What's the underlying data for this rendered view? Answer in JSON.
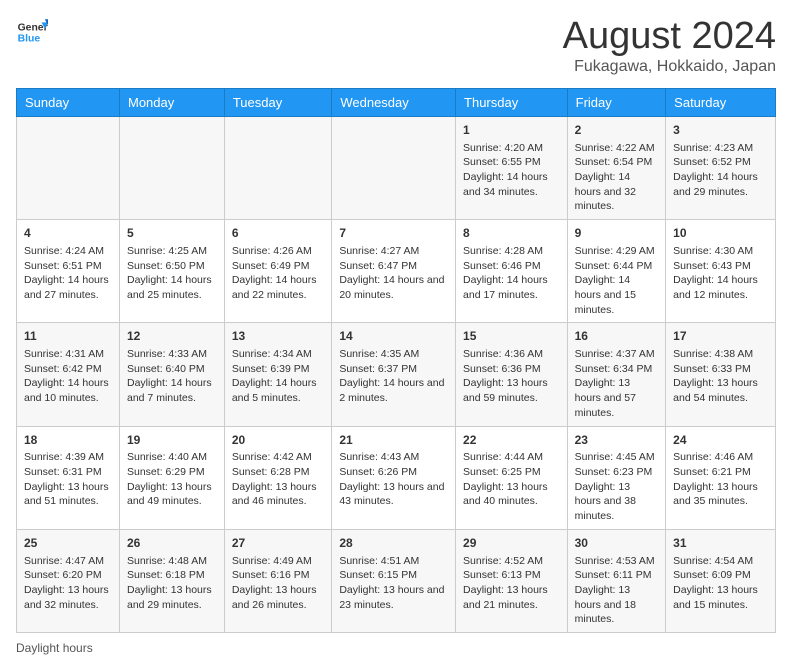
{
  "logo": {
    "line1": "General",
    "line2": "Blue"
  },
  "title": "August 2024",
  "location": "Fukagawa, Hokkaido, Japan",
  "days_of_week": [
    "Sunday",
    "Monday",
    "Tuesday",
    "Wednesday",
    "Thursday",
    "Friday",
    "Saturday"
  ],
  "weeks": [
    [
      {
        "day": "",
        "content": ""
      },
      {
        "day": "",
        "content": ""
      },
      {
        "day": "",
        "content": ""
      },
      {
        "day": "",
        "content": ""
      },
      {
        "day": "1",
        "content": "Sunrise: 4:20 AM\nSunset: 6:55 PM\nDaylight: 14 hours\nand 34 minutes."
      },
      {
        "day": "2",
        "content": "Sunrise: 4:22 AM\nSunset: 6:54 PM\nDaylight: 14 hours\nand 32 minutes."
      },
      {
        "day": "3",
        "content": "Sunrise: 4:23 AM\nSunset: 6:52 PM\nDaylight: 14 hours\nand 29 minutes."
      }
    ],
    [
      {
        "day": "4",
        "content": "Sunrise: 4:24 AM\nSunset: 6:51 PM\nDaylight: 14 hours\nand 27 minutes."
      },
      {
        "day": "5",
        "content": "Sunrise: 4:25 AM\nSunset: 6:50 PM\nDaylight: 14 hours\nand 25 minutes."
      },
      {
        "day": "6",
        "content": "Sunrise: 4:26 AM\nSunset: 6:49 PM\nDaylight: 14 hours\nand 22 minutes."
      },
      {
        "day": "7",
        "content": "Sunrise: 4:27 AM\nSunset: 6:47 PM\nDaylight: 14 hours\nand 20 minutes."
      },
      {
        "day": "8",
        "content": "Sunrise: 4:28 AM\nSunset: 6:46 PM\nDaylight: 14 hours\nand 17 minutes."
      },
      {
        "day": "9",
        "content": "Sunrise: 4:29 AM\nSunset: 6:44 PM\nDaylight: 14 hours\nand 15 minutes."
      },
      {
        "day": "10",
        "content": "Sunrise: 4:30 AM\nSunset: 6:43 PM\nDaylight: 14 hours\nand 12 minutes."
      }
    ],
    [
      {
        "day": "11",
        "content": "Sunrise: 4:31 AM\nSunset: 6:42 PM\nDaylight: 14 hours\nand 10 minutes."
      },
      {
        "day": "12",
        "content": "Sunrise: 4:33 AM\nSunset: 6:40 PM\nDaylight: 14 hours\nand 7 minutes."
      },
      {
        "day": "13",
        "content": "Sunrise: 4:34 AM\nSunset: 6:39 PM\nDaylight: 14 hours\nand 5 minutes."
      },
      {
        "day": "14",
        "content": "Sunrise: 4:35 AM\nSunset: 6:37 PM\nDaylight: 14 hours\nand 2 minutes."
      },
      {
        "day": "15",
        "content": "Sunrise: 4:36 AM\nSunset: 6:36 PM\nDaylight: 13 hours\nand 59 minutes."
      },
      {
        "day": "16",
        "content": "Sunrise: 4:37 AM\nSunset: 6:34 PM\nDaylight: 13 hours\nand 57 minutes."
      },
      {
        "day": "17",
        "content": "Sunrise: 4:38 AM\nSunset: 6:33 PM\nDaylight: 13 hours\nand 54 minutes."
      }
    ],
    [
      {
        "day": "18",
        "content": "Sunrise: 4:39 AM\nSunset: 6:31 PM\nDaylight: 13 hours\nand 51 minutes."
      },
      {
        "day": "19",
        "content": "Sunrise: 4:40 AM\nSunset: 6:29 PM\nDaylight: 13 hours\nand 49 minutes."
      },
      {
        "day": "20",
        "content": "Sunrise: 4:42 AM\nSunset: 6:28 PM\nDaylight: 13 hours\nand 46 minutes."
      },
      {
        "day": "21",
        "content": "Sunrise: 4:43 AM\nSunset: 6:26 PM\nDaylight: 13 hours\nand 43 minutes."
      },
      {
        "day": "22",
        "content": "Sunrise: 4:44 AM\nSunset: 6:25 PM\nDaylight: 13 hours\nand 40 minutes."
      },
      {
        "day": "23",
        "content": "Sunrise: 4:45 AM\nSunset: 6:23 PM\nDaylight: 13 hours\nand 38 minutes."
      },
      {
        "day": "24",
        "content": "Sunrise: 4:46 AM\nSunset: 6:21 PM\nDaylight: 13 hours\nand 35 minutes."
      }
    ],
    [
      {
        "day": "25",
        "content": "Sunrise: 4:47 AM\nSunset: 6:20 PM\nDaylight: 13 hours\nand 32 minutes."
      },
      {
        "day": "26",
        "content": "Sunrise: 4:48 AM\nSunset: 6:18 PM\nDaylight: 13 hours\nand 29 minutes."
      },
      {
        "day": "27",
        "content": "Sunrise: 4:49 AM\nSunset: 6:16 PM\nDaylight: 13 hours\nand 26 minutes."
      },
      {
        "day": "28",
        "content": "Sunrise: 4:51 AM\nSunset: 6:15 PM\nDaylight: 13 hours\nand 23 minutes."
      },
      {
        "day": "29",
        "content": "Sunrise: 4:52 AM\nSunset: 6:13 PM\nDaylight: 13 hours\nand 21 minutes."
      },
      {
        "day": "30",
        "content": "Sunrise: 4:53 AM\nSunset: 6:11 PM\nDaylight: 13 hours\nand 18 minutes."
      },
      {
        "day": "31",
        "content": "Sunrise: 4:54 AM\nSunset: 6:09 PM\nDaylight: 13 hours\nand 15 minutes."
      }
    ]
  ],
  "footer": {
    "daylight_label": "Daylight hours"
  }
}
